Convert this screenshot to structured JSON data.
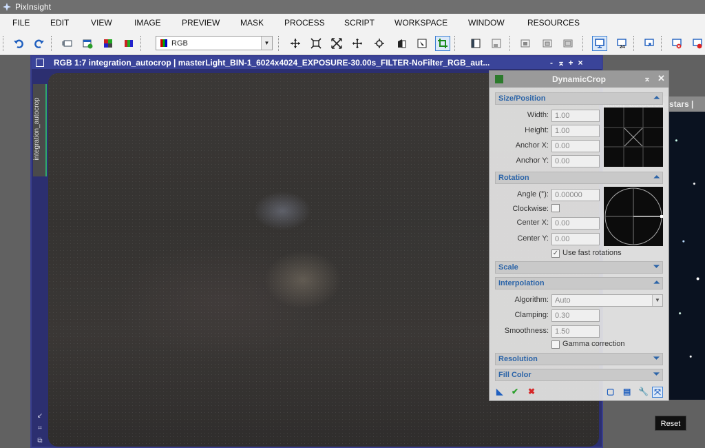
{
  "app": {
    "title": "PixInsight"
  },
  "menu": [
    "FILE",
    "EDIT",
    "VIEW",
    "IMAGE",
    "PREVIEW",
    "MASK",
    "PROCESS",
    "SCRIPT",
    "WORKSPACE",
    "WINDOW",
    "RESOURCES"
  ],
  "toolbar": {
    "channel_select_value": "RGB"
  },
  "image_window": {
    "title": "RGB 1:7 integration_autocrop | masterLight_BIN-1_6024x4024_EXPOSURE-30.00s_FILTER-NoFilter_RGB_aut...",
    "side_tab_label": "integration_autocrop",
    "controls": [
      "-",
      "⌅",
      "+",
      "×"
    ]
  },
  "background_window": {
    "title_fragment": "ration_autocrop_stars |"
  },
  "dynamic_crop": {
    "title": "DynamicCrop",
    "sections": {
      "size_position": "Size/Position",
      "rotation": "Rotation",
      "scale": "Scale",
      "interpolation": "Interpolation",
      "resolution": "Resolution",
      "fill_color": "Fill Color"
    },
    "fields": {
      "width_label": "Width:",
      "width_value": "1.00",
      "height_label": "Height:",
      "height_value": "1.00",
      "anchor_x_label": "Anchor X:",
      "anchor_x_value": "0.00",
      "anchor_y_label": "Anchor Y:",
      "anchor_y_value": "0.00",
      "angle_label": "Angle (°):",
      "angle_value": "0.00000",
      "clockwise_label": "Clockwise:",
      "center_x_label": "Center X:",
      "center_x_value": "0.00",
      "center_y_label": "Center Y:",
      "center_y_value": "0.00",
      "fast_rotations_label": "Use fast rotations",
      "algorithm_label": "Algorithm:",
      "algorithm_value": "Auto",
      "clamping_label": "Clamping:",
      "clamping_value": "0.30",
      "smoothness_label": "Smoothness:",
      "smoothness_value": "1.50",
      "gamma_label": "Gamma correction"
    },
    "checkboxes": {
      "clockwise": false,
      "use_fast_rotations": true,
      "gamma_correction": false
    }
  },
  "tooltip": {
    "text": "Reset"
  },
  "colors": {
    "window_blue": "#3a4499",
    "section_text": "#2b64a8",
    "apply_green": "#2ca02c",
    "cancel_red": "#d62728"
  }
}
